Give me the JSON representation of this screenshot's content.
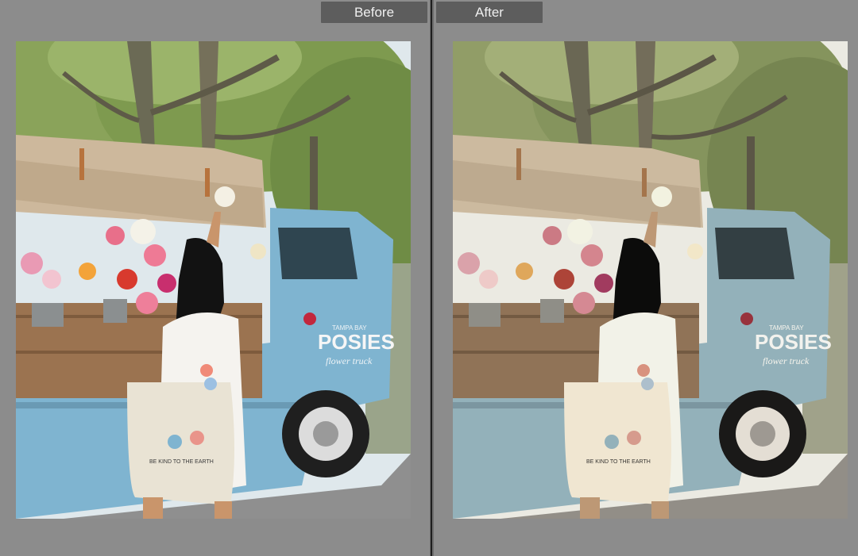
{
  "compare": {
    "before_label": "Before",
    "after_label": "After"
  },
  "photo": {
    "truck_text_brand": "POSIES",
    "truck_text_sub": "flower truck",
    "truck_text_top": "TAMPA BAY",
    "bag_text": "BE KIND TO THE EARTH"
  },
  "colors": {
    "background": "#8a8a8a",
    "label_bg": "#5d5d5d",
    "truck_blue": "#7fb4d0",
    "canopy": "#cdb89c"
  }
}
